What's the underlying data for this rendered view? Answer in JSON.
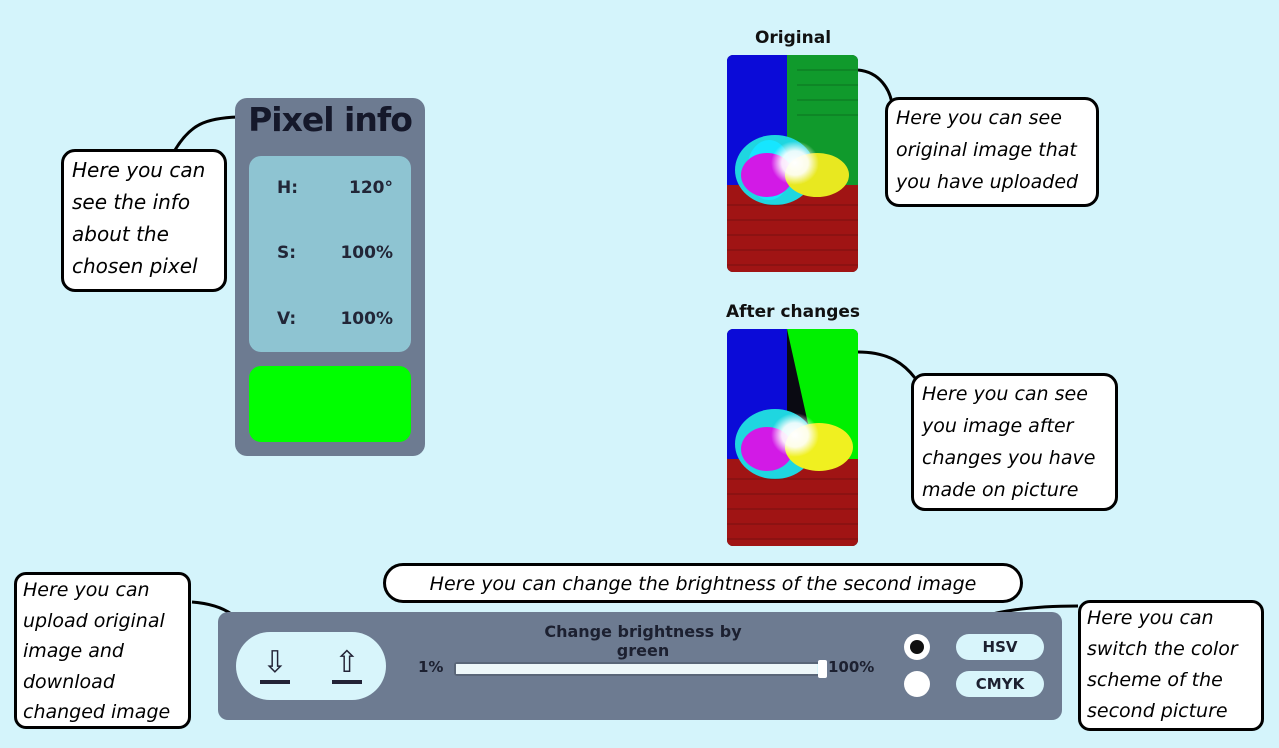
{
  "pixel_info": {
    "title": "Pixel info",
    "rows": [
      {
        "label": "H:",
        "value": "120°"
      },
      {
        "label": "S:",
        "value": "100%"
      },
      {
        "label": "V:",
        "value": "100%"
      }
    ],
    "swatch_color": "#00ff00"
  },
  "images": {
    "original_title": "Original",
    "after_title": "After changes"
  },
  "controls": {
    "slider_title": "Change brightness by green",
    "min_label": "1%",
    "max_label": "100%",
    "slider_value_fraction": 0.98,
    "scheme_options": [
      "HSV",
      "CMYK"
    ],
    "selected_scheme": "HSV",
    "upload_icon": "download-arrow-icon",
    "download_icon": "upload-arrow-icon"
  },
  "callouts": {
    "pixel": "Here you can\nsee the info\nabout the\nchosen pixel",
    "original": "Here you can see\noriginal image that\nyou have uploaded",
    "after": "Here you can see\nyou image after\nchanges you have\nmade on picture",
    "brightness": "Here you can change the brightness of the second image",
    "upload": "Here you can\nupload original\nimage and\ndownload\nchanged image",
    "scheme": "Here you can\nswitch the color\nscheme of the\nsecond picture"
  }
}
